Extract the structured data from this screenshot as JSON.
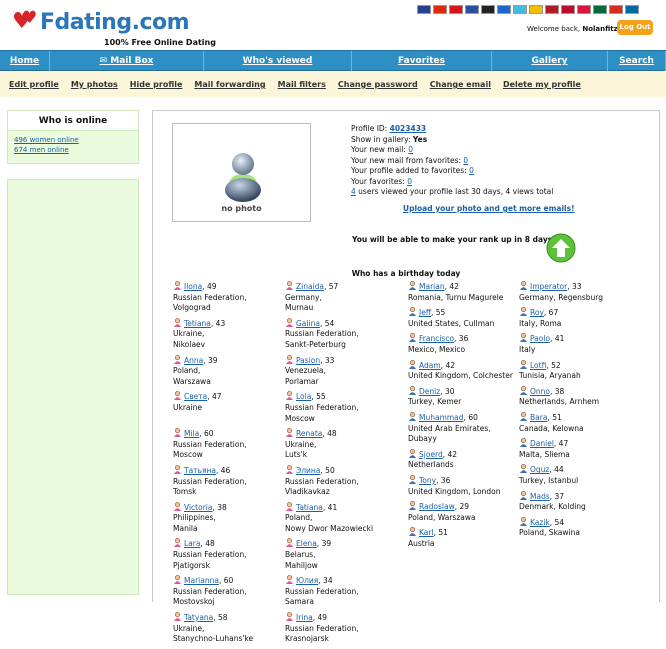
{
  "header": {
    "logo_text": "Fdating.com",
    "tagline": "100% Free Online Dating",
    "welcome_prefix": "Welcome back, ",
    "username": "Nolanfitz!",
    "logout_label": "Log Out"
  },
  "colors": {
    "brand_blue": "#2a76b8",
    "nav_blue": "#2d8fc4",
    "heart_red": "#d7262b",
    "logout_orange": "#f2a31b",
    "link": "#1a5fa8"
  },
  "flags": [
    {
      "name": "united-kingdom",
      "color": "#26408b"
    },
    {
      "name": "china",
      "color": "#de2910"
    },
    {
      "name": "czech",
      "color": "#d7141a"
    },
    {
      "name": "france",
      "color": "#2b4fa0"
    },
    {
      "name": "germany",
      "color": "#222222"
    },
    {
      "name": "ukraine",
      "color": "#1c67c7"
    },
    {
      "name": "kazakhstan",
      "color": "#46b9df"
    },
    {
      "name": "spain",
      "color": "#f1bf00"
    },
    {
      "name": "netherlands",
      "color": "#ae1c28"
    },
    {
      "name": "norway",
      "color": "#ba0c2f"
    },
    {
      "name": "poland",
      "color": "#dc143c"
    },
    {
      "name": "portugal",
      "color": "#046a38"
    },
    {
      "name": "russia",
      "color": "#d52b1e"
    },
    {
      "name": "sweden",
      "color": "#006aa7"
    }
  ],
  "nav": {
    "items": [
      "Home",
      "Mail Box",
      "Who's viewed",
      "Favorites",
      "Gallery",
      "Search"
    ]
  },
  "subnav": {
    "items": [
      "Edit profile",
      "My photos",
      "Hide profile",
      "Mail forwarding",
      "Mail filters",
      "Change password",
      "Change email",
      "Delete my profile"
    ]
  },
  "sidebar": {
    "title": "Who is online",
    "women": "496 women online",
    "men": "674 men online"
  },
  "photo": {
    "label": "no photo"
  },
  "profile": {
    "id_label": "Profile ID: ",
    "id_value": "4023433",
    "gallery_label": "Show in gallery: ",
    "gallery_value": "Yes",
    "new_mail_label": "Your new mail: ",
    "new_mail_value": "0",
    "fav_mail_label": "Your new mail from favorites: ",
    "fav_mail_value": "0",
    "added_label": "Your profile added to favorites: ",
    "added_value": "0",
    "favorites_label": "Your favorites: ",
    "favorites_value": "0",
    "viewed_value": "4",
    "viewed_text": " users viewed your profile last 30 days, 4 views total",
    "upload_link": "Upload your photo and get more emails!",
    "rank_text": "You will be able to make your rank up in 8 days"
  },
  "birthday": {
    "title": "Who has a birthday today",
    "columns": [
      [
        {
          "name": "Ilona",
          "age": ", 49",
          "l1": "Russian Federation,",
          "l2": "Volgograd"
        },
        {
          "name": "Tetiana",
          "age": ", 43",
          "l1": "Ukraine,",
          "l2": "Nikolaev"
        },
        {
          "name": "Anna",
          "age": ", 39",
          "l1": "Poland,",
          "l2": "Warszawa"
        },
        {
          "name": "Света",
          "age": ", 47",
          "l1": "Ukraine",
          "l2": ""
        },
        {
          "name": "Mila",
          "age": ", 60",
          "l1": "Russian Federation,",
          "l2": "Moscow"
        },
        {
          "name": "Татьяна",
          "age": ", 46",
          "l1": "Russian Federation,",
          "l2": "Tomsk"
        },
        {
          "name": "Victoria",
          "age": ", 38",
          "l1": "Philippines,",
          "l2": "Manila"
        },
        {
          "name": "Lara",
          "age": ", 48",
          "l1": "Russian Federation,",
          "l2": "Pjatigorsk"
        },
        {
          "name": "Marianna",
          "age": ", 60",
          "l1": "Russian Federation,",
          "l2": "Mostovskoj"
        },
        {
          "name": "Tatyana",
          "age": ", 58",
          "l1": "Ukraine,",
          "l2": "Stanychno-Luhans'ke"
        }
      ],
      [
        {
          "name": "Zinaida",
          "age": ", 57",
          "l1": "Germany,",
          "l2": "Murnau"
        },
        {
          "name": "Galina",
          "age": ", 54",
          "l1": "Russian Federation,",
          "l2": "Sankt-Peterburg"
        },
        {
          "name": "Pasion",
          "age": ", 33",
          "l1": "Venezuela,",
          "l2": "Porlamar"
        },
        {
          "name": "Lola",
          "age": ", 55",
          "l1": "Russian Federation,",
          "l2": "Moscow"
        },
        {
          "name": "Renata",
          "age": ", 48",
          "l1": "Ukraine,",
          "l2": "Luts'k"
        },
        {
          "name": "Элина",
          "age": ", 50",
          "l1": "Russian Federation,",
          "l2": "Vladikavkaz"
        },
        {
          "name": "Tatiana",
          "age": ", 41",
          "l1": "Poland,",
          "l2": "Nowy Dwor Mazowiecki"
        },
        {
          "name": "Elena",
          "age": ", 39",
          "l1": "Belarus,",
          "l2": "Mahiljow"
        },
        {
          "name": "Юлия",
          "age": ", 34",
          "l1": "Russian Federation,",
          "l2": "Samara"
        },
        {
          "name": "Irina",
          "age": ", 49",
          "l1": "Russian Federation,",
          "l2": "Krasnojarsk"
        }
      ],
      [
        {
          "name": "Marian",
          "age": ", 42",
          "l1": "Romania, Turnu Magurele",
          "l2": ""
        },
        {
          "name": "Jeff",
          "age": ", 55",
          "l1": "United States, Cullman",
          "l2": ""
        },
        {
          "name": "Francisco",
          "age": ", 36",
          "l1": "Mexico, Mexico",
          "l2": ""
        },
        {
          "name": "Adam",
          "age": ", 42",
          "l1": "United Kingdom, Colchester",
          "l2": ""
        },
        {
          "name": "Deniz",
          "age": ", 30",
          "l1": "Turkey, Kemer",
          "l2": ""
        },
        {
          "name": "Muhammad",
          "age": ", 60",
          "l1": "United Arab Emirates, Dubayy",
          "l2": ""
        },
        {
          "name": "Sjoerd",
          "age": ", 42",
          "l1": "Netherlands",
          "l2": ""
        },
        {
          "name": "Tony",
          "age": ", 36",
          "l1": "United Kingdom, London",
          "l2": ""
        },
        {
          "name": "Radoslaw",
          "age": ", 29",
          "l1": "Poland, Warszawa",
          "l2": ""
        },
        {
          "name": "Karl",
          "age": ", 51",
          "l1": "Austria",
          "l2": ""
        }
      ],
      [
        {
          "name": "Imperator",
          "age": ", 33",
          "l1": "Germany, Regensburg",
          "l2": ""
        },
        {
          "name": "Roy",
          "age": ", 67",
          "l1": "Italy, Roma",
          "l2": ""
        },
        {
          "name": "Paolo",
          "age": ", 41",
          "l1": "Italy",
          "l2": ""
        },
        {
          "name": "Lotfi",
          "age": ", 52",
          "l1": "Tunisia, Aryanah",
          "l2": ""
        },
        {
          "name": "Onno",
          "age": ", 38",
          "l1": "Netherlands, Arnhem",
          "l2": ""
        },
        {
          "name": "Bara",
          "age": ", 51",
          "l1": "Canada, Kelowna",
          "l2": ""
        },
        {
          "name": "Daniel",
          "age": ", 47",
          "l1": "Malta, Sliema",
          "l2": ""
        },
        {
          "name": "Oguz",
          "age": ", 44",
          "l1": "Turkey, Istanbul",
          "l2": ""
        },
        {
          "name": "Mads",
          "age": ", 37",
          "l1": "Denmark, Kolding",
          "l2": ""
        },
        {
          "name": "Kazik",
          "age": ", 54",
          "l1": "Poland, Skawina",
          "l2": ""
        }
      ]
    ]
  }
}
